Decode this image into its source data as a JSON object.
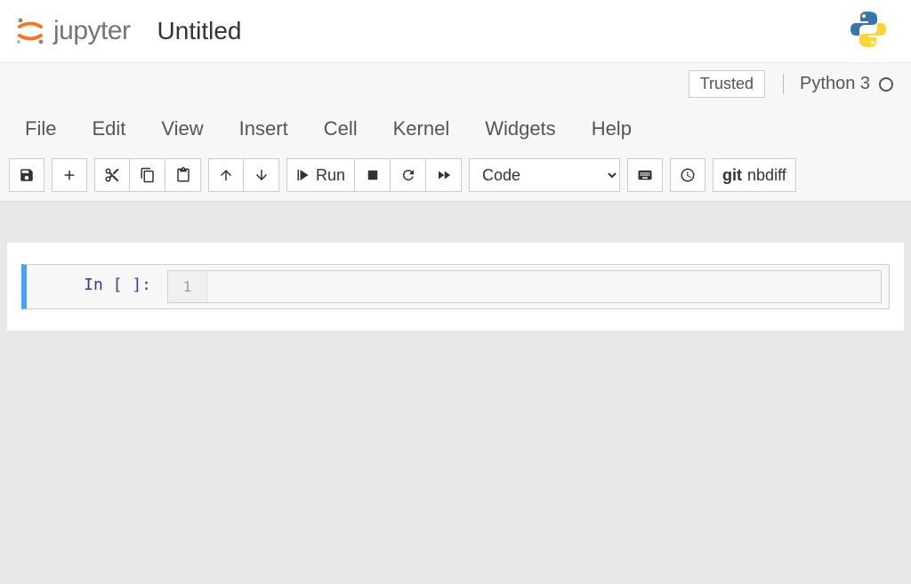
{
  "header": {
    "logo_text": "jupyter",
    "notebook_title": "Untitled"
  },
  "status": {
    "trusted": "Trusted",
    "kernel": "Python 3"
  },
  "menu": {
    "file": "File",
    "edit": "Edit",
    "view": "View",
    "insert": "Insert",
    "cell": "Cell",
    "kernel": "Kernel",
    "widgets": "Widgets",
    "help": "Help"
  },
  "toolbar": {
    "run_label": "Run",
    "cell_type": "Code",
    "nbdiff_label": "nbdiff",
    "git_label": "git"
  },
  "cell": {
    "prompt": "In [ ]:",
    "line_number": "1",
    "content": ""
  }
}
